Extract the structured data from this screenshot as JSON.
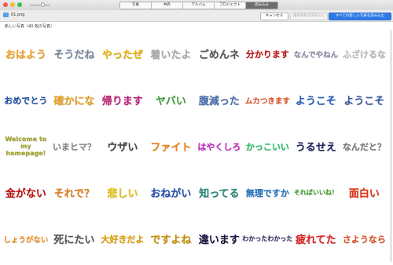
{
  "titlebar": {
    "tabs": [
      {
        "label": "写真",
        "active": false
      },
      {
        "label": "共有",
        "active": false
      },
      {
        "label": "アルバム",
        "active": false
      },
      {
        "label": "プロジェクト",
        "active": false
      },
      {
        "label": "読み込み",
        "active": true
      }
    ]
  },
  "toolbar": {
    "file_name": "01.png",
    "cancel_label": "キャンセル",
    "import_selected_label": "選択項目を読み込む",
    "import_all_label": "すべての新しい写真を読み込む"
  },
  "section": {
    "label": "新しい写真（40 枚の写真）"
  },
  "grid": [
    {
      "text": "おはよう",
      "color": "#f0a020"
    },
    {
      "text": "そうだね",
      "color": "#7a8aa0"
    },
    {
      "text": "やったぜ",
      "color": "#e8b000"
    },
    {
      "text": "着いたよ",
      "color": "#aaaaaa"
    },
    {
      "text": "ごめんネ",
      "color": "#555555"
    },
    {
      "text": "分かります",
      "color": "#c01010"
    },
    {
      "text": "なんでやねん",
      "color": "#8f8aa8"
    },
    {
      "text": "ふざけるな",
      "color": "#bbbbbb"
    },
    {
      "text": "おめでとう",
      "color": "#1a4aa8"
    },
    {
      "text": "確かにな",
      "color": "#e8a020"
    },
    {
      "text": "帰ります",
      "color": "#c0207a"
    },
    {
      "text": "ヤバい",
      "color": "#40a040"
    },
    {
      "text": "腹減った",
      "color": "#4a70b0"
    },
    {
      "text": "ムカつきます",
      "color": "#e85020"
    },
    {
      "text": "ようこそ",
      "color": "#2060c0"
    },
    {
      "text": "ようこそ",
      "color": "#3a5aa8"
    },
    {
      "text": "Welcome to my homepage!",
      "color": "#a0a020"
    },
    {
      "text": "いまヒマ？",
      "color": "#888888"
    },
    {
      "text": "ウザい",
      "color": "#444444"
    },
    {
      "text": "ファイト",
      "color": "#f08010"
    },
    {
      "text": "はやくしろ",
      "color": "#c020c0"
    },
    {
      "text": "かっこいい",
      "color": "#20c060"
    },
    {
      "text": "うるせえ",
      "color": "#202060"
    },
    {
      "text": "なんだと？",
      "color": "#777777"
    },
    {
      "text": "金がない",
      "color": "#c01010"
    },
    {
      "text": "それで？",
      "color": "#e08020"
    },
    {
      "text": "悲しい",
      "color": "#e8c000"
    },
    {
      "text": "おねがい",
      "color": "#2050b0"
    },
    {
      "text": "知ってる",
      "color": "#2a8a7a"
    },
    {
      "text": "無理ですか",
      "color": "#2070c0"
    },
    {
      "text": "そればいいね！",
      "color": "#40a020"
    },
    {
      "text": "面白い",
      "color": "#e03010"
    },
    {
      "text": "しょうがない",
      "color": "#f09020"
    },
    {
      "text": "死にたい",
      "color": "#555555"
    },
    {
      "text": "大好きだよ",
      "color": "#e0a000"
    },
    {
      "text": "ですよね",
      "color": "#c89000"
    },
    {
      "text": "違います",
      "color": "#151540"
    },
    {
      "text": "わかったわかった",
      "color": "#2a2a6a"
    },
    {
      "text": "疲れてた",
      "color": "#e02020"
    },
    {
      "text": "さようなら",
      "color": "#e05020"
    }
  ]
}
